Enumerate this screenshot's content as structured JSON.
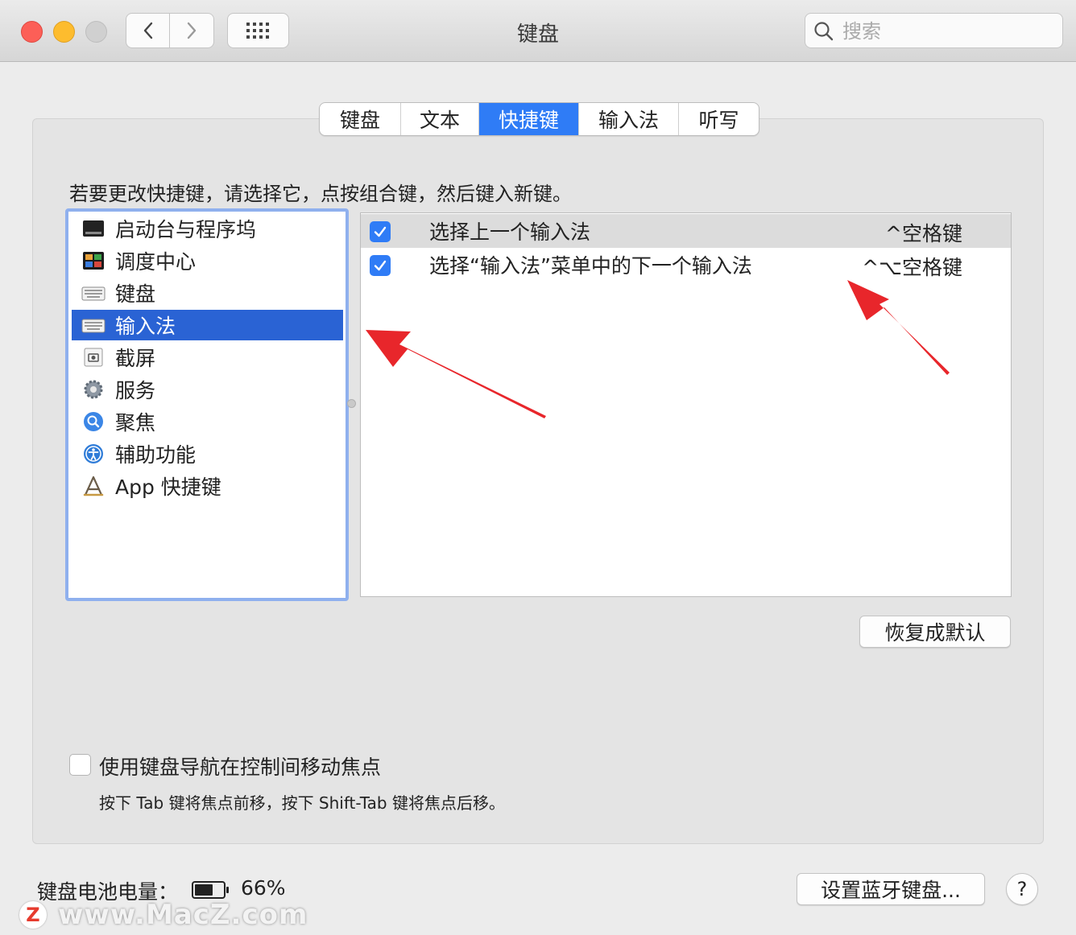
{
  "window": {
    "title": "键盘"
  },
  "search": {
    "placeholder": "搜索"
  },
  "tabs": [
    {
      "label": "键盘",
      "active": false
    },
    {
      "label": "文本",
      "active": false
    },
    {
      "label": "快捷键",
      "active": true
    },
    {
      "label": "输入法",
      "active": false
    },
    {
      "label": "听写",
      "active": false
    }
  ],
  "instruction": "若要更改快捷键，请选择它，点按组合键，然后键入新键。",
  "categories": [
    {
      "label": "启动台与程序坞",
      "icon": "launchpad-dock-icon"
    },
    {
      "label": "调度中心",
      "icon": "mission-control-icon"
    },
    {
      "label": "键盘",
      "icon": "keyboard-icon"
    },
    {
      "label": "输入法",
      "icon": "keyboard-icon",
      "selected": true
    },
    {
      "label": "截屏",
      "icon": "screenshot-icon"
    },
    {
      "label": "服务",
      "icon": "gear-icon"
    },
    {
      "label": "聚焦",
      "icon": "spotlight-icon"
    },
    {
      "label": "辅助功能",
      "icon": "accessibility-icon"
    },
    {
      "label": "App 快捷键",
      "icon": "app-shortcuts-icon"
    }
  ],
  "shortcuts": [
    {
      "name": "选择上一个输入法",
      "keys": "^空格键",
      "checked": true
    },
    {
      "name": "选择“输入法”菜单中的下一个输入法",
      "keys": "^⌥空格键",
      "checked": true
    }
  ],
  "buttons": {
    "restore_defaults": "恢复成默认",
    "bluetooth_keyboard": "设置蓝牙键盘...",
    "help": "?"
  },
  "keyboard_navigation": {
    "label": "使用键盘导航在控制间移动焦点",
    "hint": "按下 Tab 键将焦点前移，按下 Shift-Tab 键将焦点后移。",
    "checked": false
  },
  "battery": {
    "label": "键盘电池电量：",
    "value": "66%",
    "level": 0.66
  },
  "watermark": {
    "logo": "Z",
    "text": "www.MacZ.com"
  },
  "colors": {
    "accent": "#2f7cf6",
    "selection": "#2a63d4",
    "annotation_arrow": "#e8262b"
  }
}
